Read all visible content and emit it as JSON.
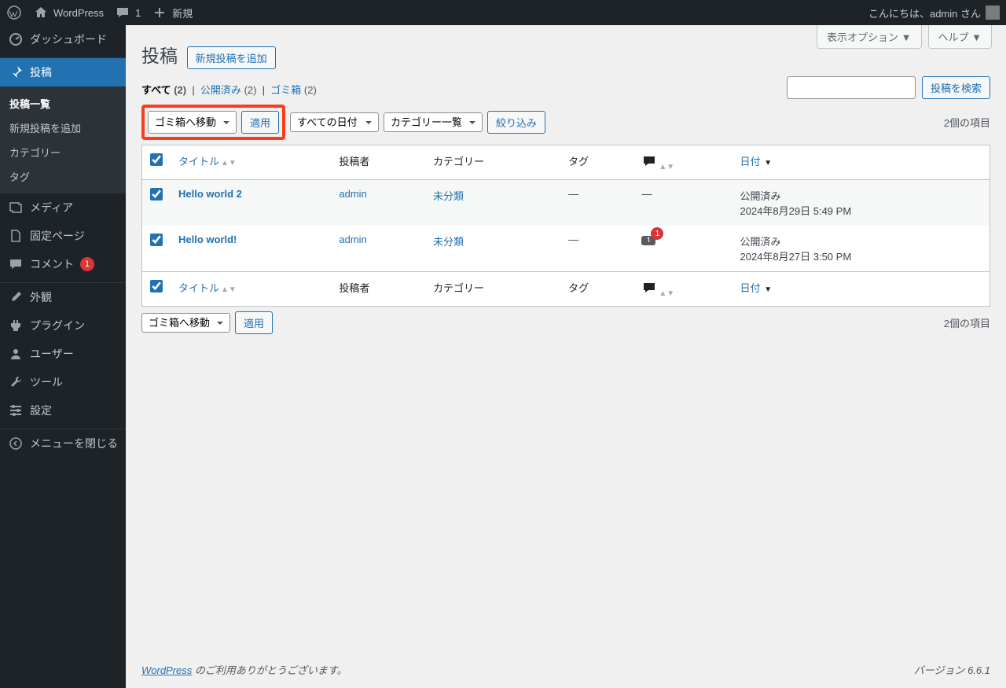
{
  "adminbar": {
    "site": "WordPress",
    "comments": "1",
    "new": "新規",
    "greeting": "こんにちは、admin さん"
  },
  "sidebar": {
    "dashboard": "ダッシュボード",
    "posts": "投稿",
    "posts_sub": {
      "all": "投稿一覧",
      "new": "新規投稿を追加",
      "categories": "カテゴリー",
      "tags": "タグ"
    },
    "media": "メディア",
    "pages": "固定ページ",
    "comments": "コメント",
    "comments_badge": "1",
    "appearance": "外観",
    "plugins": "プラグイン",
    "users": "ユーザー",
    "tools": "ツール",
    "settings": "設定",
    "collapse": "メニューを閉じる"
  },
  "screen": {
    "options": "表示オプション",
    "help": "ヘルプ"
  },
  "page": {
    "title": "投稿",
    "add_new": "新規投稿を追加"
  },
  "filters": {
    "all": "すべて",
    "all_count": "(2)",
    "published": "公開済み",
    "published_count": "(2)",
    "trash": "ゴミ箱",
    "trash_count": "(2)"
  },
  "search": {
    "button": "投稿を検索"
  },
  "bulk": {
    "action": "ゴミ箱へ移動",
    "apply": "適用",
    "dates": "すべての日付",
    "cats": "カテゴリー一覧",
    "filter": "絞り込み"
  },
  "items_count": "2個の項目",
  "columns": {
    "title": "タイトル",
    "author": "投稿者",
    "category": "カテゴリー",
    "tag": "タグ",
    "date": "日付"
  },
  "rows": [
    {
      "title": "Hello world 2",
      "author": "admin",
      "category": "未分類",
      "tag": "—",
      "comments": "—",
      "status": "公開済み",
      "date": "2024年8月29日 5:49 PM"
    },
    {
      "title": "Hello world!",
      "author": "admin",
      "category": "未分類",
      "tag": "—",
      "comments": "1",
      "comments_badge": "1",
      "status": "公開済み",
      "date": "2024年8月27日 3:50 PM"
    }
  ],
  "footer": {
    "thanks_link": "WordPress",
    "thanks_text": " のご利用ありがとうございます。",
    "version": "バージョン 6.6.1"
  }
}
